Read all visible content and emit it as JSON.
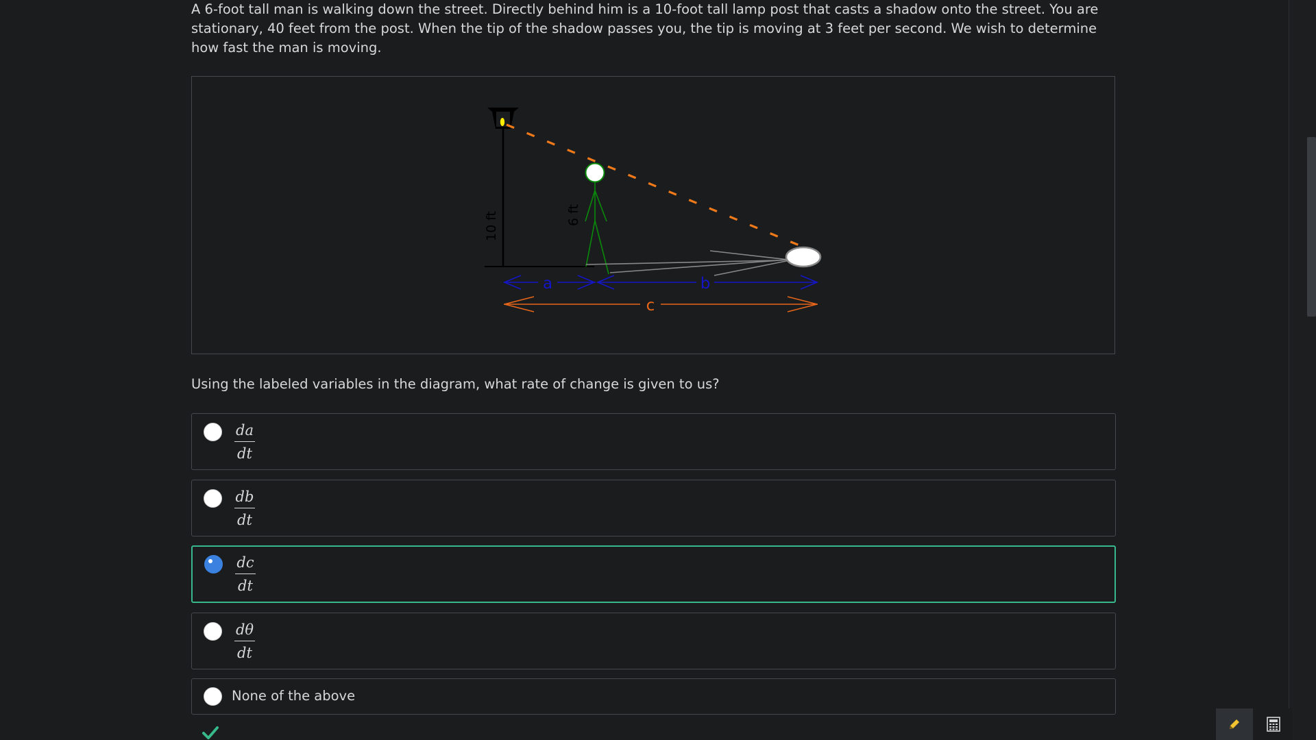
{
  "problem": {
    "text": "A 6-foot tall man is walking down the street. Directly behind him is a 10-foot tall lamp post that casts a shadow onto the street. You are stationary, 40 feet from the post. When the tip of the shadow passes you, the tip is moving at 3 feet per second. We wish to determine how fast the man is moving."
  },
  "diagram": {
    "post_height_label": "10 ft",
    "man_height_label": "6 ft",
    "label_a": "a",
    "label_b": "b",
    "label_c": "c",
    "colors": {
      "post": "#000000",
      "man": "#0a8a0a",
      "shadow_line": "#f07a1a",
      "ab_arrows": "#1515c8",
      "c_arrow": "#e8661a",
      "lamp_light": "#ffee00",
      "observer": "#888888"
    }
  },
  "question": {
    "text": "Using the labeled variables in the diagram, what rate of change is given to us?"
  },
  "choices": [
    {
      "num": "da",
      "den": "dt",
      "selected": false
    },
    {
      "num": "db",
      "den": "dt",
      "selected": false
    },
    {
      "num": "dc",
      "den": "dt",
      "selected": true
    },
    {
      "num": "dθ",
      "den": "dt",
      "selected": false
    },
    {
      "label": "None of the above",
      "selected": false
    }
  ],
  "status": {
    "icon": "checkmark-icon",
    "color": "#37b98b"
  },
  "toolbar": {
    "pencil_icon": "pencil-icon",
    "calculator_icon": "calculator-icon"
  },
  "theme": {
    "background": "#1a1c1e",
    "border": "#45494e",
    "accent_selected": "#37b98b",
    "radio_selected": "#3b82e0"
  }
}
